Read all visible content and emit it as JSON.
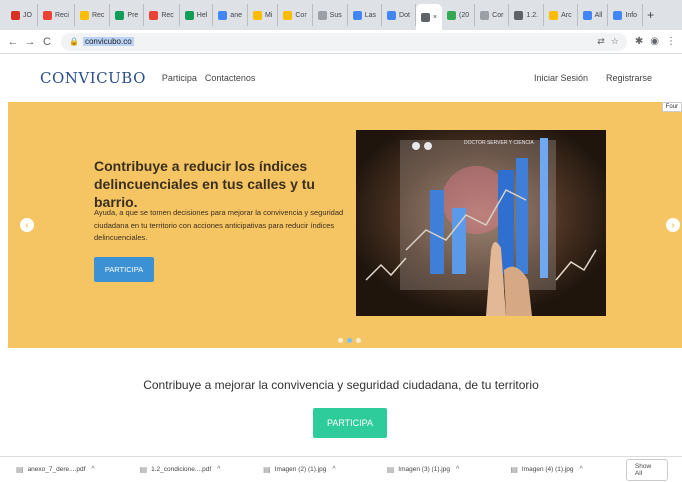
{
  "browser": {
    "tabs": [
      {
        "label": "JO",
        "color": "#d93025"
      },
      {
        "label": "Reci",
        "color": "#ea4335"
      },
      {
        "label": "Rec",
        "color": "#fbbc04"
      },
      {
        "label": "Pre",
        "color": "#0f9d58"
      },
      {
        "label": "Rec",
        "color": "#ea4335"
      },
      {
        "label": "Hel",
        "color": "#0f9d58"
      },
      {
        "label": "ane",
        "color": "#4285f4"
      },
      {
        "label": "Mi",
        "color": "#fbbc04"
      },
      {
        "label": "Cor",
        "color": "#fbbc04"
      },
      {
        "label": "Sus",
        "color": "#9aa0a6"
      },
      {
        "label": "Las",
        "color": "#4285f4"
      },
      {
        "label": "Dot",
        "color": "#4285f4"
      },
      {
        "label": "×",
        "color": "#5f6368",
        "active": true
      },
      {
        "label": "(20",
        "color": "#34a853"
      },
      {
        "label": "Cor",
        "color": "#9aa0a6"
      },
      {
        "label": "1.2.",
        "color": "#5f6368"
      },
      {
        "label": "Arc",
        "color": "#fbbc04"
      },
      {
        "label": "All",
        "color": "#4285f4"
      },
      {
        "label": "Info",
        "color": "#4285f4"
      }
    ],
    "new_tab": "+",
    "url": "convicubo.co"
  },
  "site": {
    "logo": "CONVICUBO",
    "nav": {
      "participa": "Participa",
      "contactenos": "Contactenos",
      "login": "Iniciar Sesión",
      "register": "Registrarse"
    },
    "page_tab": "Four"
  },
  "carousel": {
    "headline": "Contribuye a reducir los índices delincuenciales en tus calles y tu barrio.",
    "body": "Ayuda, a que se tomen decisiones para mejorar la convivencia y seguridad ciudadana en tu territorio con acciones anticipativas para reducir índices delincuenciales.",
    "button": "PARTICIPA",
    "slides": 3,
    "active_slide": 1,
    "hero_caption": "DOCTOR SERVER Y CIENCIA"
  },
  "section": {
    "tagline": "Contribuye a mejorar la convivencia y seguridad ciudadana, de tu territorio",
    "button": "PARTICIPA"
  },
  "downloads": {
    "items": [
      "anexo_7_dere....pdf",
      "1.2_condicione....pdf",
      "Imagen (2) (1).jpg",
      "Imagen (3) (1).jpg",
      "Imagen (4) (1).jpg"
    ],
    "show_all": "Show All"
  },
  "colors": {
    "banner": "#f6c563",
    "small_button": "#3c91d4",
    "big_button": "#2ecc9a",
    "logo": "#2b4f8c"
  }
}
